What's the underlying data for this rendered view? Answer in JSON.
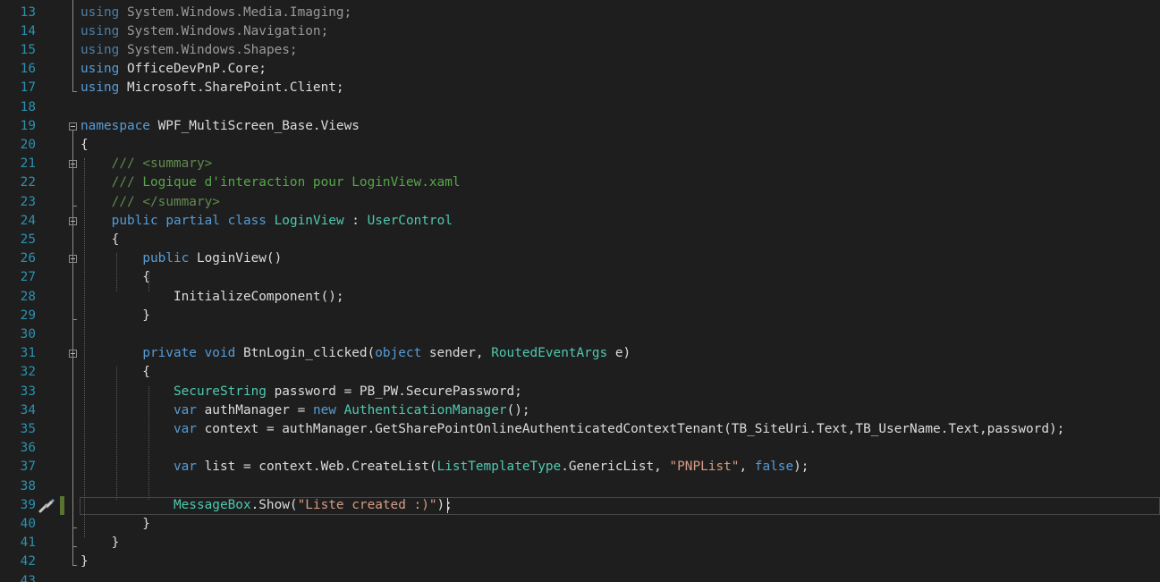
{
  "editor": {
    "line_numbers": [
      "13",
      "14",
      "15",
      "16",
      "17",
      "18",
      "19",
      "20",
      "21",
      "22",
      "23",
      "24",
      "25",
      "26",
      "27",
      "28",
      "29",
      "30",
      "31",
      "32",
      "33",
      "34",
      "35",
      "36",
      "37",
      "38",
      "39",
      "40",
      "41",
      "42",
      "43"
    ],
    "lines": [
      [
        {
          "t": "using",
          "c": "dim"
        },
        {
          "t": " System.Windows.Media.Imaging;",
          "c": "dimtext"
        }
      ],
      [
        {
          "t": "using",
          "c": "dim"
        },
        {
          "t": " System.Windows.Navigation;",
          "c": "dimtext"
        }
      ],
      [
        {
          "t": "using",
          "c": "dim"
        },
        {
          "t": " System.Windows.Shapes;",
          "c": "dimtext"
        }
      ],
      [
        {
          "t": "using",
          "c": "kw"
        },
        {
          "t": " OfficeDevPnP.Core;"
        }
      ],
      [
        {
          "t": "using",
          "c": "kw"
        },
        {
          "t": " Microsoft.SharePoint.Client;"
        }
      ],
      [],
      [
        {
          "t": "namespace",
          "c": "kw"
        },
        {
          "t": " WPF_MultiScreen_Base.Views"
        }
      ],
      [
        {
          "t": "{"
        }
      ],
      [
        {
          "t": "    "
        },
        {
          "t": "///",
          "c": "comtag"
        },
        {
          "t": " ",
          "c": "com"
        },
        {
          "t": "<summary>",
          "c": "comtag"
        }
      ],
      [
        {
          "t": "    "
        },
        {
          "t": "///",
          "c": "comtag"
        },
        {
          "t": " Logique d'interaction pour LoginView.xaml",
          "c": "com"
        }
      ],
      [
        {
          "t": "    "
        },
        {
          "t": "///",
          "c": "comtag"
        },
        {
          "t": " ",
          "c": "com"
        },
        {
          "t": "</summary>",
          "c": "comtag"
        }
      ],
      [
        {
          "t": "    "
        },
        {
          "t": "public",
          "c": "kw"
        },
        {
          "t": " "
        },
        {
          "t": "partial",
          "c": "kw"
        },
        {
          "t": " "
        },
        {
          "t": "class",
          "c": "kw"
        },
        {
          "t": " "
        },
        {
          "t": "LoginView",
          "c": "type"
        },
        {
          "t": " : "
        },
        {
          "t": "UserControl",
          "c": "type"
        }
      ],
      [
        {
          "t": "    {"
        }
      ],
      [
        {
          "t": "        "
        },
        {
          "t": "public",
          "c": "kw"
        },
        {
          "t": " LoginView()"
        }
      ],
      [
        {
          "t": "        {"
        }
      ],
      [
        {
          "t": "            InitializeComponent();"
        }
      ],
      [
        {
          "t": "        }"
        }
      ],
      [],
      [
        {
          "t": "        "
        },
        {
          "t": "private",
          "c": "kw"
        },
        {
          "t": " "
        },
        {
          "t": "void",
          "c": "kw"
        },
        {
          "t": " BtnLogin_clicked("
        },
        {
          "t": "object",
          "c": "kw"
        },
        {
          "t": " sender, "
        },
        {
          "t": "RoutedEventArgs",
          "c": "type"
        },
        {
          "t": " e)"
        }
      ],
      [
        {
          "t": "        {"
        }
      ],
      [
        {
          "t": "            "
        },
        {
          "t": "SecureString",
          "c": "type"
        },
        {
          "t": " password = PB_PW.SecurePassword;"
        }
      ],
      [
        {
          "t": "            "
        },
        {
          "t": "var",
          "c": "kw"
        },
        {
          "t": " authManager = "
        },
        {
          "t": "new",
          "c": "kw"
        },
        {
          "t": " "
        },
        {
          "t": "AuthenticationManager",
          "c": "type"
        },
        {
          "t": "();"
        }
      ],
      [
        {
          "t": "            "
        },
        {
          "t": "var",
          "c": "kw"
        },
        {
          "t": " context = authManager.GetSharePointOnlineAuthenticatedContextTenant(TB_SiteUri.Text,TB_UserName.Text,password);"
        }
      ],
      [],
      [
        {
          "t": "            "
        },
        {
          "t": "var",
          "c": "kw"
        },
        {
          "t": " list = context.Web.CreateList("
        },
        {
          "t": "ListTemplateType",
          "c": "type"
        },
        {
          "t": ".GenericList, "
        },
        {
          "t": "\"PNPList\"",
          "c": "str"
        },
        {
          "t": ", "
        },
        {
          "t": "false",
          "c": "kw"
        },
        {
          "t": ");"
        }
      ],
      [],
      [
        {
          "t": "            "
        },
        {
          "t": "MessageBox",
          "c": "type"
        },
        {
          "t": ".Show("
        },
        {
          "t": "\"Liste created :)\"",
          "c": "str"
        },
        {
          "t": ");"
        }
      ],
      [
        {
          "t": "        }"
        }
      ],
      [
        {
          "t": "    }"
        }
      ],
      [
        {
          "t": "}"
        }
      ],
      []
    ],
    "fold_markers": [
      "namespace",
      "summary",
      "class",
      "constructor",
      "method"
    ],
    "quick_action_icon": "screwdriver-lightbulb-icon",
    "colors": {
      "background": "#1e1e1e",
      "line_number": "#2b91af",
      "keyword": "#569cd6",
      "type": "#4ec9b0",
      "string": "#d69d85",
      "comment": "#57a64a",
      "text": "#dcdcdc",
      "change_bar": "#577430"
    }
  }
}
